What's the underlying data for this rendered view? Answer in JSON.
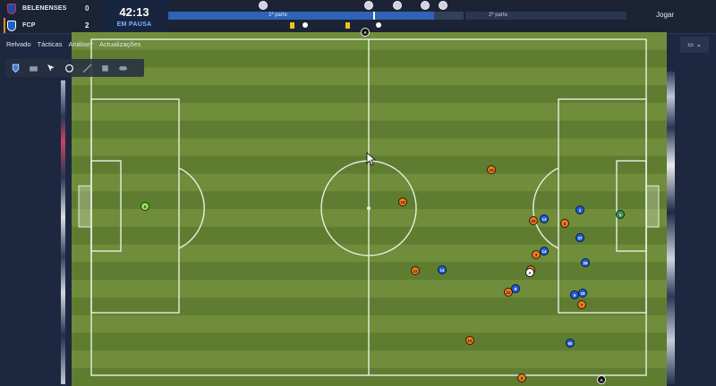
{
  "scoreboard": {
    "home": {
      "name": "BELENENSES",
      "score": "0"
    },
    "away": {
      "name": "FCP",
      "score": "2"
    },
    "clock": "42:13",
    "status": "EM PAUSA",
    "first_half_label": "1ª parte",
    "second_half_label": "2ª parte",
    "progress_first_half": 0.9,
    "play_label": "Jogar"
  },
  "tabs": [
    {
      "label": "Relvado",
      "active": true
    },
    {
      "label": "Tácticas",
      "active": false
    },
    {
      "label": "Análise*",
      "active": false
    },
    {
      "label": "Actualizações",
      "active": false
    }
  ],
  "toolbar": {
    "tools": [
      "team-icon",
      "camera-icon",
      "cursor-icon",
      "record-icon",
      "stats-icon",
      "formation-icon",
      "tactics-icon"
    ]
  },
  "colors": {
    "home_team": "#f07a1c",
    "away_team": "#1f5ed9",
    "pitch_light": "#6f8d3a",
    "pitch_dark": "#5f7d31"
  },
  "players": [
    {
      "team": "gk-orange",
      "number": "5"
    },
    {
      "team": "orange",
      "number": "15"
    },
    {
      "team": "orange",
      "number": "19"
    },
    {
      "team": "orange",
      "number": "20"
    },
    {
      "team": "orange",
      "number": "6"
    },
    {
      "team": "orange",
      "number": "3"
    },
    {
      "team": "orange",
      "number": "11"
    },
    {
      "team": "orange",
      "number": "22"
    },
    {
      "team": "orange",
      "number": "7"
    },
    {
      "team": "orange",
      "number": "10"
    },
    {
      "team": "orange",
      "number": "9"
    },
    {
      "team": "orange",
      "number": "8"
    },
    {
      "team": "blue",
      "number": "2"
    },
    {
      "team": "blue",
      "number": "13"
    },
    {
      "team": "blue",
      "number": "37"
    },
    {
      "team": "blue",
      "number": "14"
    },
    {
      "team": "blue",
      "number": "25"
    },
    {
      "team": "blue",
      "number": "14"
    },
    {
      "team": "blue",
      "number": "8"
    },
    {
      "team": "blue",
      "number": "6"
    },
    {
      "team": "blue",
      "number": "15"
    },
    {
      "team": "blue",
      "number": "90"
    },
    {
      "team": "gk-blue",
      "number": "1"
    },
    {
      "team": "ref",
      "number": "A"
    },
    {
      "team": "ref-black",
      "number": "A"
    },
    {
      "team": "ref-black",
      "number": "A"
    }
  ]
}
